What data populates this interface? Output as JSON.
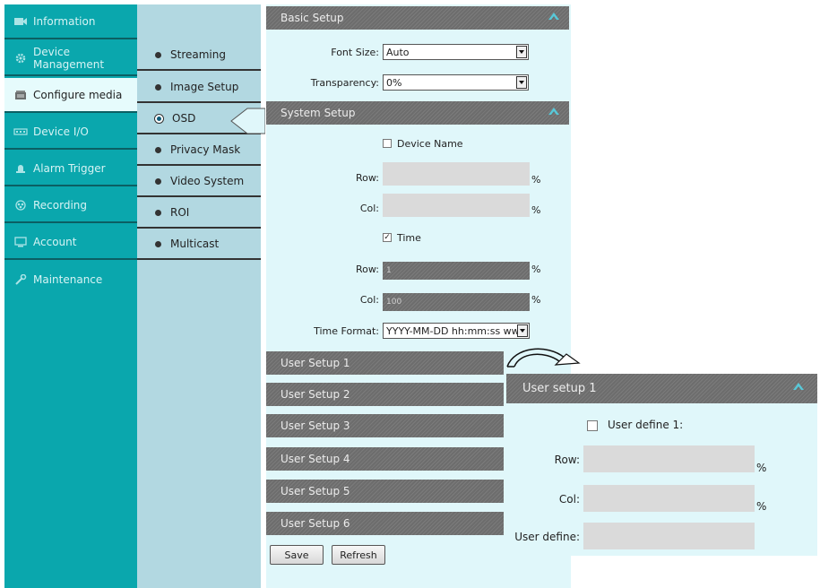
{
  "nav": {
    "items": [
      {
        "label": "Information",
        "icon": "camera-icon"
      },
      {
        "label": "Device Management",
        "icon": "gear-icon"
      },
      {
        "label": "Configure media",
        "icon": "media-icon"
      },
      {
        "label": "Device I/O",
        "icon": "io-icon"
      },
      {
        "label": "Alarm Trigger",
        "icon": "alarm-icon"
      },
      {
        "label": "Recording",
        "icon": "recording-icon"
      },
      {
        "label": "Account",
        "icon": "account-icon"
      },
      {
        "label": "Maintenance",
        "icon": "wrench-icon"
      }
    ],
    "active_index": 2
  },
  "submenu": {
    "items": [
      "Streaming",
      "Image Setup",
      "OSD",
      "Privacy Mask",
      "Video System",
      "ROI",
      "Multicast"
    ],
    "active_index": 2
  },
  "basic_setup": {
    "title": "Basic Setup",
    "font_size_label": "Font Size:",
    "font_size_value": "Auto",
    "transparency_label": "Transparency:",
    "transparency_value": "0%"
  },
  "system_setup": {
    "title": "System Setup",
    "device_name_label": "Device Name",
    "device_name_checked": false,
    "device_row_label": "Row:",
    "device_col_label": "Col:",
    "time_label": "Time",
    "time_checked": true,
    "time_row_label": "Row:",
    "time_row_value": "1",
    "time_col_label": "Col:",
    "time_col_value": "100",
    "time_format_label": "Time Format:",
    "time_format_value": "YYYY-MM-DD hh:mm:ss ww",
    "percent": "%"
  },
  "user_setups": [
    "User Setup 1",
    "User Setup 2",
    "User Setup 3",
    "User Setup 4",
    "User Setup 5",
    "User Setup 6"
  ],
  "buttons": {
    "save": "Save",
    "refresh": "Refresh"
  },
  "zoom": {
    "title": "User setup 1",
    "user_define_check_label": "User define 1:",
    "row_label": "Row:",
    "col_label": "Col:",
    "user_define_label": "User define:",
    "percent": "%"
  },
  "colors": {
    "nav_bg": "#0aa7ad",
    "submenu_bg": "#b2d8e1",
    "content_bg": "#e0f7fa",
    "bar_bg": "#767676"
  }
}
